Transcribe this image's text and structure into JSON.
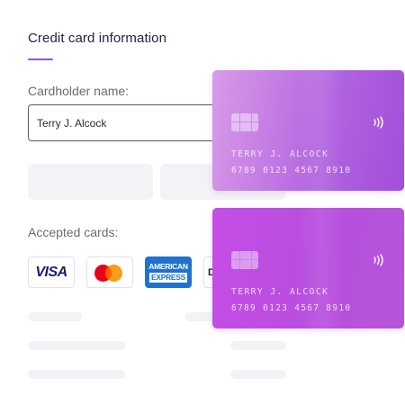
{
  "section": {
    "title": "Credit card information"
  },
  "form": {
    "cardholder_label": "Cardholder name:",
    "cardholder_value": "Terry J. Alcock",
    "accepted_label": "Accepted cards:"
  },
  "accepted_cards": {
    "visa": "VISA",
    "amex_line1": "AMERICAN",
    "amex_line2": "EXPRESS",
    "discover_partial": "D"
  },
  "cards": [
    {
      "holder": "TERRY J. ALCOCK",
      "number": "6789 0123 4567 8910",
      "icons": [
        "chip-icon",
        "contactless-icon"
      ]
    },
    {
      "holder": "TERRY J. ALCOCK",
      "number": "6789 0123 4567 8910",
      "icons": [
        "chip-icon",
        "contactless-icon"
      ]
    }
  ],
  "colors": {
    "accent": "#8e54d6",
    "card_top_start": "#d89be8",
    "card_top_end": "#a24fdb",
    "card_bottom": "#c44ee6",
    "visa_blue": "#1a1f71",
    "amex_blue": "#1f72cd",
    "mastercard_red": "#eb001b",
    "mastercard_yellow": "#f79e1b"
  }
}
